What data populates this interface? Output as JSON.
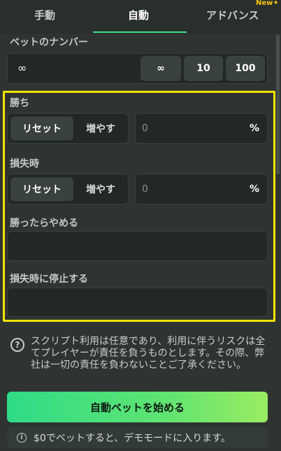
{
  "tabs": {
    "manual": "手動",
    "auto": "自動",
    "advanced": "アドバンス",
    "new_badge": "New"
  },
  "bet_count": {
    "label": "ベットのナンバー",
    "value": "∞",
    "presets": [
      "∞",
      "10",
      "100"
    ]
  },
  "on_win": {
    "label": "勝ち",
    "reset": "リセット",
    "increase": "増やす",
    "value": "0",
    "unit": "%"
  },
  "on_loss": {
    "label": "損失時",
    "reset": "リセット",
    "increase": "増やす",
    "value": "0",
    "unit": "%"
  },
  "stop_on_profit": {
    "label": "勝ったらやめる",
    "value": ""
  },
  "stop_on_loss": {
    "label": "損失時に停止する",
    "value": ""
  },
  "disclaimer": "スクリプト利用は任意であり、利用に伴うリスクは全てプレイヤーが責任を負うものとします。その際、弊社は一切の責任を負わないことご了承ください。",
  "start_button": "自動ベットを始める",
  "demo_notice": "$0でベットすると、デモモードに入ります。",
  "colors": {
    "accent_green": "#3fe08a",
    "highlight_yellow": "#f5e400"
  }
}
